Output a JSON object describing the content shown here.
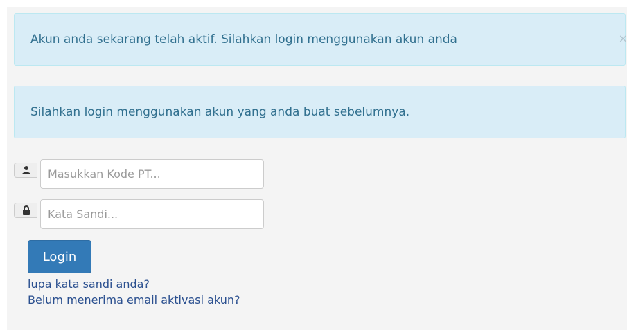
{
  "alerts": {
    "activated_message": "Akun anda sekarang telah aktif. Silahkan login menggunakan akun anda",
    "close_symbol": "×",
    "login_info_message": "Silahkan login menggunakan akun yang anda buat sebelumnya."
  },
  "form": {
    "code_placeholder": "Masukkan Kode PT...",
    "code_icon": "user-icon",
    "password_placeholder": "Kata Sandi...",
    "password_icon": "lock-icon",
    "login_label": "Login"
  },
  "links": {
    "forgot_password": "lupa kata sandi anda?",
    "resend_activation": "Belum menerima email aktivasi akun?"
  },
  "colors": {
    "alert_background": "#d9edf7",
    "alert_text": "#31708f",
    "button_primary": "#337ab7",
    "link": "#2a4f8f"
  }
}
